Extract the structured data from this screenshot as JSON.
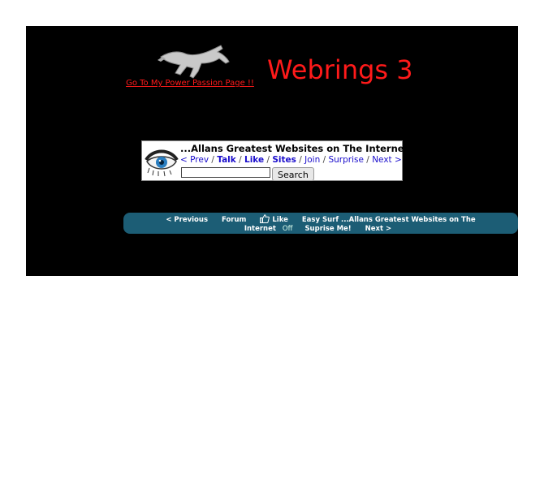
{
  "header": {
    "power_link": "Go To My Power Passion Page !!",
    "title": "Webrings 3"
  },
  "webring": {
    "title": "...Allans Greatest Websites on The Internet",
    "nav": {
      "prev": "< Prev",
      "talk": "Talk",
      "like": "Like",
      "sites": "Sites",
      "join": "Join",
      "surprise": "Surprise",
      "next": "Next >"
    },
    "search_value": "",
    "search_button": "Search"
  },
  "toolbar": {
    "previous": "< Previous",
    "forum": "Forum",
    "like": "Like",
    "easy_surf": "Easy Surf ...Allans Greatest Websites on The",
    "internet": "Internet",
    "off": "Off",
    "surprise": "Suprise Me!",
    "next": "Next >",
    "bar_color": "#1c5d75"
  },
  "colors": {
    "title_red": "#ff1a1a",
    "background": "#000000",
    "link_blue": "#1a0dcc"
  }
}
